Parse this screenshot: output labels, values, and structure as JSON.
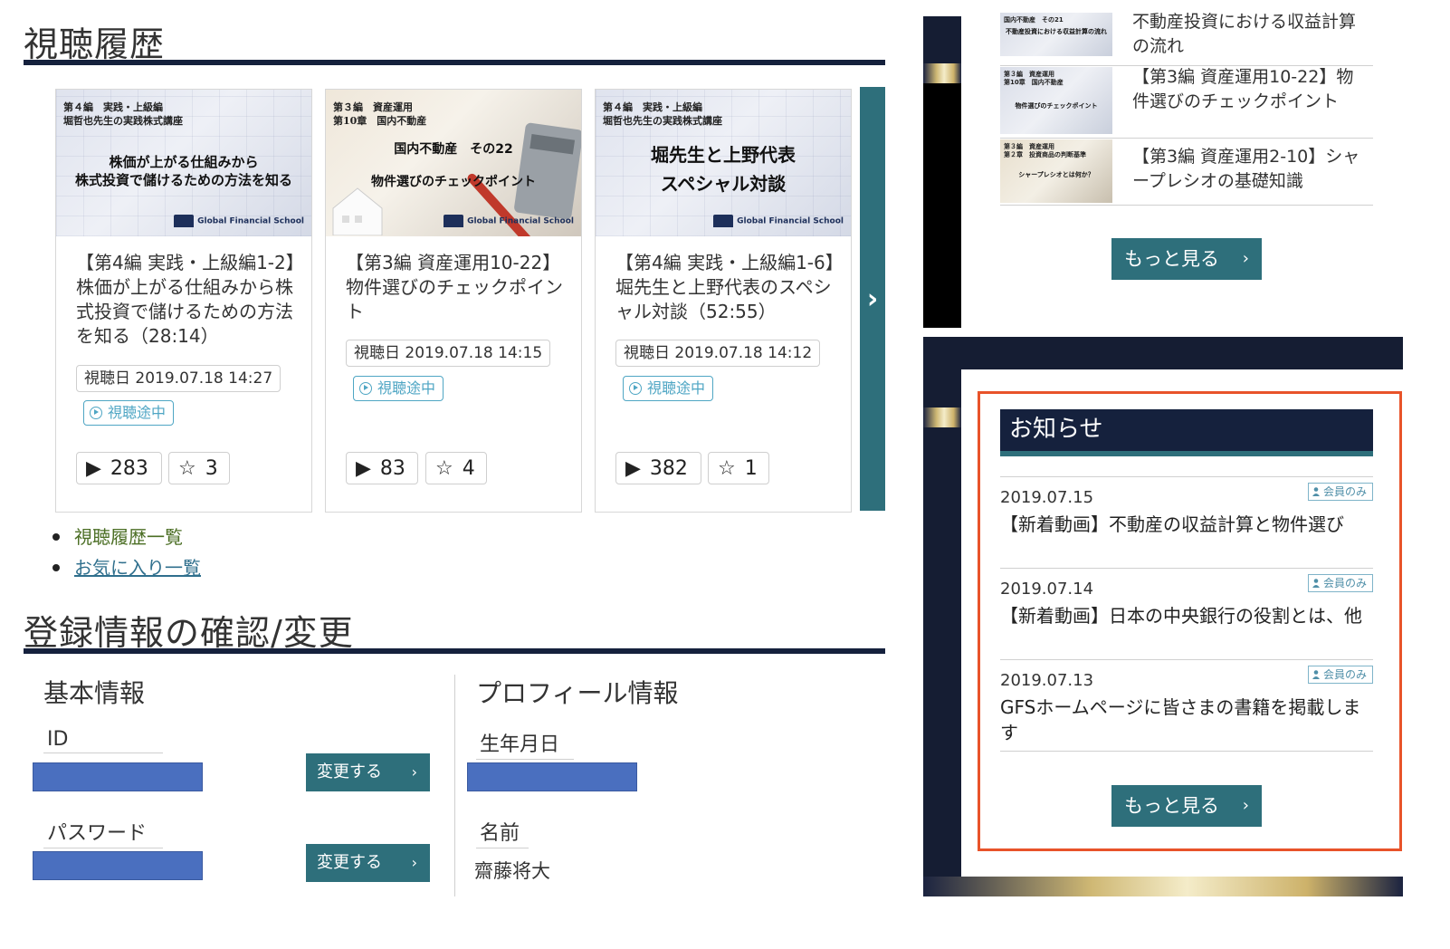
{
  "history": {
    "title": "視聴履歴",
    "cards": [
      {
        "thumb_series": "第４編　実践・上級編\n堀哲也先生の実践株式講座",
        "thumb_lesson": "株価が上がる仕組みから\n株式投資で儲けるための方法を知る",
        "thumb_brand": "Global Financial School",
        "title": "【第4編 実践・上級編1-2】株価が上がる仕組みから株式投資で儲けるための方法を知る（28:14）",
        "viewed": "視聴日 2019.07.18 14:27",
        "status": "視聴途中",
        "plays": "283",
        "favorites": "3"
      },
      {
        "thumb_series": "第３編　資産運用\n第10章　国内不動産",
        "thumb_lesson": "国内不動産　その22\n物件選びのチェックポイント",
        "thumb_brand": "Global Financial School",
        "title": "【第3編 資産運用10-22】物件選びのチェックポイント",
        "viewed": "視聴日 2019.07.18 14:15",
        "status": "視聴途中",
        "plays": "83",
        "favorites": "4"
      },
      {
        "thumb_series": "第４編　実践・上級編\n堀哲也先生の実践株式講座",
        "thumb_lesson": "堀先生と上野代表\nスペシャル対談",
        "thumb_brand": "Global Financial School",
        "title": "【第4編 実践・上級編1-6】堀先生と上野代表のスペシャル対談（52:55）",
        "viewed": "視聴日 2019.07.18 14:12",
        "status": "視聴途中",
        "plays": "382",
        "favorites": "1"
      }
    ],
    "next_label": "›",
    "links": {
      "list": "視聴履歴一覧",
      "favorites": "お気に入り一覧"
    }
  },
  "registration": {
    "title": "登録情報の確認/変更",
    "basic": {
      "title": "基本情報",
      "id_label": "ID",
      "password_label": "パスワード",
      "change_label": "変更する"
    },
    "profile": {
      "title": "プロフィール情報",
      "birthday_label": "生年月日",
      "name_label": "名前",
      "name_value": "齋藤将大"
    }
  },
  "sidebar": {
    "related": [
      {
        "thumb_title": "国内不動産　その21",
        "thumb_caption": "不動産投資における収益計算の流れ",
        "text": "不動産投資における収益計算の流れ"
      },
      {
        "thumb_title": "第３編　資産運用\n第10章　国内不動産",
        "thumb_caption": "物件選びのチェックポイント",
        "text": "【第3編 資産運用10-22】物件選びのチェックポイント"
      },
      {
        "thumb_title": "第３編　資産運用\n第２章　投資商品の判断基準",
        "thumb_caption": "シャープレシオとは何か？",
        "text": "【第3編 資産運用2-10】シャープレシオの基礎知識"
      }
    ],
    "more_label": "もっと見る",
    "notices": {
      "title": "お知らせ",
      "items": [
        {
          "date": "2019.07.15",
          "badge": "会員のみ",
          "text": "【新着動画】不動産の収益計算と物件選び"
        },
        {
          "date": "2019.07.14",
          "badge": "会員のみ",
          "text": "【新着動画】日本の中央銀行の役割とは、他"
        },
        {
          "date": "2019.07.13",
          "badge": "会員のみ",
          "text": "GFSホームページに皆さまの書籍を掲載します"
        }
      ],
      "more_label": "もっと見る"
    }
  },
  "colors": {
    "navy": "#15213d",
    "teal": "#2e6f7b",
    "highlight": "#e8532a",
    "masked": "#4a6fbf",
    "link_green": "#4b6e24",
    "link_blue": "#2f6f8d"
  }
}
